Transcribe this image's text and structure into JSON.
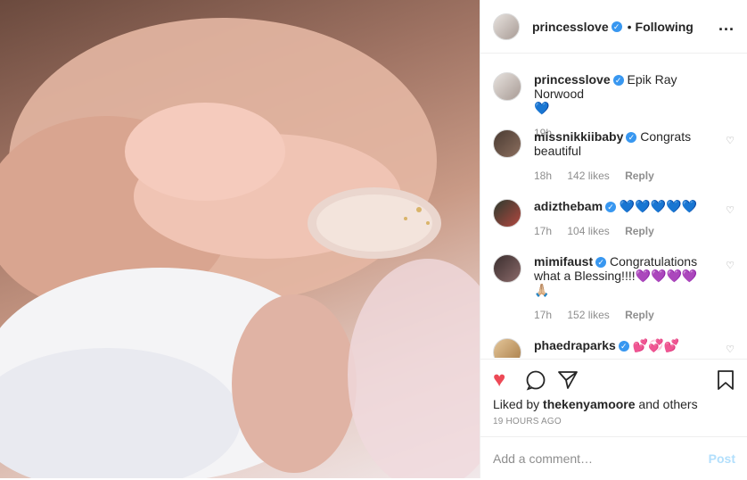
{
  "header": {
    "username": "princesslove",
    "dot": "•",
    "follow_status": "Following",
    "more": "..."
  },
  "caption": {
    "username": "princesslove",
    "text": "Epik Ray Norwood",
    "emoji": "💙",
    "time": "19h"
  },
  "comments": [
    {
      "username": "missnikkiibaby",
      "text": "Congrats beautiful",
      "time": "18h",
      "likes": "142 likes",
      "reply": "Reply"
    },
    {
      "username": "adizthebam",
      "text": "💙💙💙💙💙",
      "time": "17h",
      "likes": "104 likes",
      "reply": "Reply"
    },
    {
      "username": "mimifaust",
      "text": "Congratulations what a Blessing!!!!💜💜💜💜",
      "extra": "🙏🏼",
      "time": "17h",
      "likes": "152 likes",
      "reply": "Reply"
    },
    {
      "username": "phaedraparks",
      "text": "💕💞💕"
    }
  ],
  "icons": {
    "like": "heart-filled-icon",
    "comment": "comment-icon",
    "share": "share-icon",
    "save": "bookmark-icon"
  },
  "likes_text": {
    "prefix": "Liked by ",
    "user": "thekenyamoore",
    "suffix": " and others"
  },
  "timestamp": "19 HOURS AGO",
  "add_comment": {
    "placeholder": "Add a comment…",
    "post": "Post"
  },
  "colors": {
    "accent": "#ed4956",
    "verified": "#3897f0",
    "post_disabled": "#b2dffc"
  }
}
